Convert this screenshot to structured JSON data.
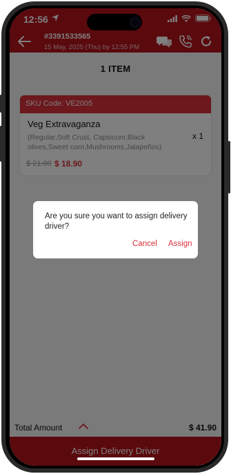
{
  "status_bar": {
    "time": "12:56",
    "icons": [
      "location-arrow-icon",
      "wifi-icon",
      "battery-icon"
    ]
  },
  "header": {
    "order_number": "#3391533565",
    "order_date": "15 May, 2025 (Thu) by 12:55 PM",
    "icons": [
      "back-arrow-icon",
      "chat-icon",
      "phone-icon",
      "refresh-icon"
    ]
  },
  "items_title": "1 ITEM",
  "item": {
    "sku": "SKU Code: VE2005",
    "name": "Veg Extravaganza",
    "description": "(Regular,Soft Crust, Capsicum,Black olives,Sweet corn,Mushrooms,Jalapeños)",
    "quantity": "x 1",
    "old_price": "$ 21.00",
    "new_price": "$ 18.90"
  },
  "total": {
    "label": "Total Amount",
    "value": "$ 41.90"
  },
  "footer_button": "Assign Delivery Driver",
  "dialog": {
    "message": "Are you sure you want to assign delivery driver?",
    "cancel_label": "Cancel",
    "assign_label": "Assign"
  },
  "colors": {
    "primary_red": "#b5121b",
    "accent_red": "#d8303a"
  }
}
